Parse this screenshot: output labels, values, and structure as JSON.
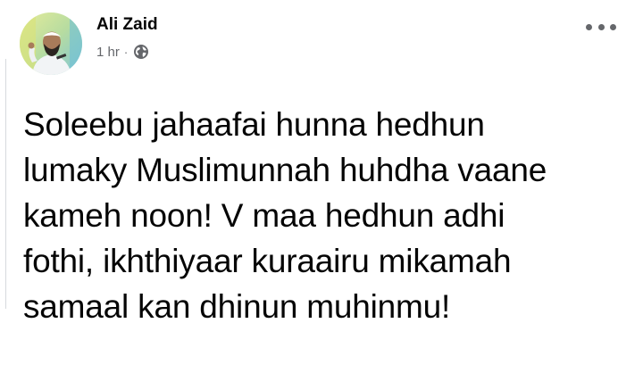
{
  "post": {
    "author_name": "Ali Zaid",
    "timestamp": "1 hr",
    "separator": "·",
    "privacy_icon": "globe-icon",
    "more_icon": "more-options-icon",
    "text_lines": [
      "Soleebu jahaafai hunna hedhun",
      "lumaky Muslimunnah huhdha vaane",
      "kameh noon! V maa hedhun adhi",
      "fothi, ikhthiyaar kuraairu mikamah",
      "samaal kan dhinun muhinmu!"
    ]
  },
  "colors": {
    "name_text": "#050505",
    "meta_text": "#65676b",
    "background": "#ffffff"
  }
}
